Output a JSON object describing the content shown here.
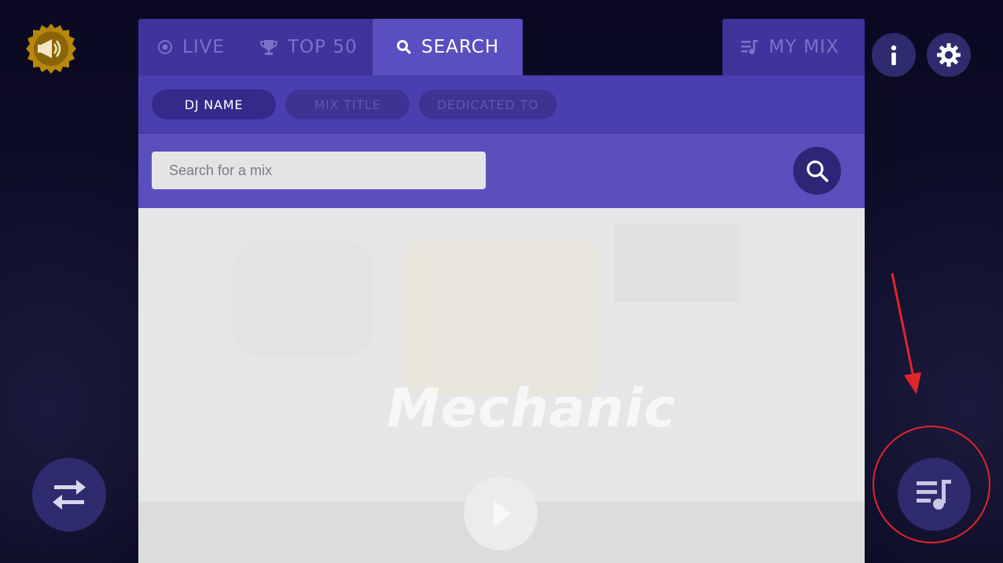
{
  "tabs": {
    "live": "LIVE",
    "top50": "TOP 50",
    "search": "SEARCH",
    "my_mix": "MY MIX"
  },
  "filters": [
    "DJ NAME",
    "MIX TITLE",
    "DEDICATED TO"
  ],
  "search": {
    "placeholder": "Search for a mix",
    "value": ""
  },
  "background": {
    "featured_title": "Mechanic"
  },
  "icons": {
    "top_left": "megaphone-badge-icon",
    "info": "info-icon",
    "settings": "gear-icon",
    "swap": "swap-arrows-icon",
    "playlist": "playlist-music-icon"
  },
  "colors": {
    "tab_bar": "#3f339c",
    "tab_active": "#5a4fc0",
    "filter_bar": "#4a3fae",
    "search_bar": "#5a4fbd",
    "round_button": "#2e2b6e",
    "annotation": "#e0252a"
  }
}
